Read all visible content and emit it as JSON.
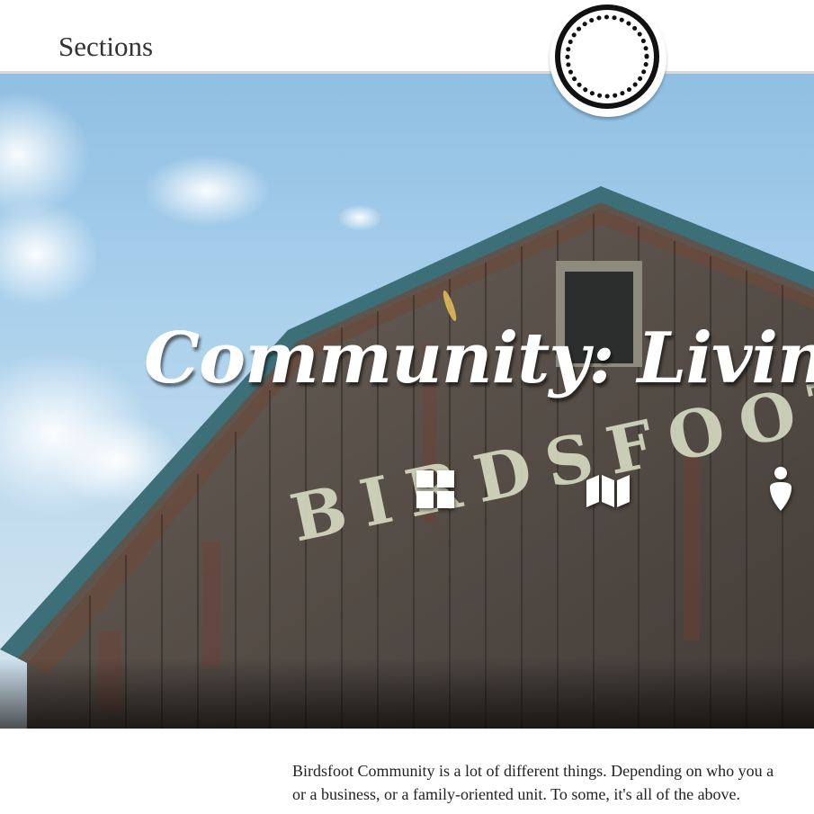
{
  "header": {
    "sections_label": "Sections"
  },
  "hero": {
    "title": "Community: Living ",
    "barn_lettering": "BIRDSFOOT",
    "icons": [
      "grid-icon",
      "map-icon",
      "location-pin-icon"
    ]
  },
  "intro": {
    "line1": "Birdsfoot Community is a lot of different things. Depending on who you a",
    "line2": "or a business, or a family-oriented unit. To some, it's all of the above."
  },
  "colors": {
    "header_bg": "#ffffff",
    "header_border": "#d9d9d9",
    "sky": "#a9d0ec",
    "barn_wood": "#5a534c",
    "roof_trim": "#3c6f77",
    "barn_letters": "#d8dcc2",
    "badge_ring": "#111111"
  }
}
